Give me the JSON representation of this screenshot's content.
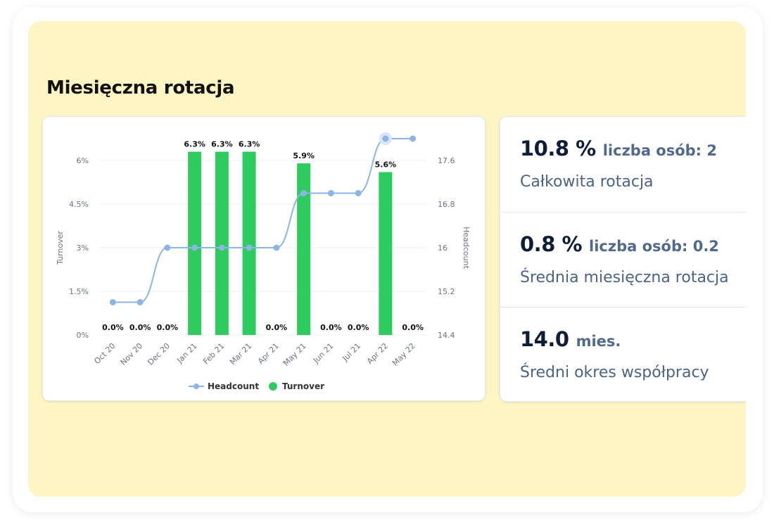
{
  "panel": {
    "title": "Miesięczna rotacja"
  },
  "stats": [
    {
      "value": "10.8 %",
      "extra": "liczba osób: 2",
      "label": "Całkowita rotacja"
    },
    {
      "value": "0.8 %",
      "extra": "liczba osób: 0.2",
      "label": "Średnia miesięczna rotacja"
    },
    {
      "value": "14.0",
      "extra": "mies.",
      "label": "Średni okres współpracy"
    }
  ],
  "colors": {
    "panel_bg": "#fdf6c4",
    "bar": "#2ecc5f",
    "line": "#8db4e6",
    "stat_value": "#0f1d36",
    "stat_text": "#4b6385"
  },
  "chart_data": {
    "type": "bar",
    "categories": [
      "Oct 20",
      "Nov 20",
      "Dec 20",
      "Jan 21",
      "Feb 21",
      "Mar 21",
      "Apr 21",
      "May 21",
      "Jun 21",
      "Jul 21",
      "Apr 22",
      "May 22"
    ],
    "series": [
      {
        "name": "Turnover",
        "type": "bar",
        "axis": "left",
        "values": [
          0,
          0,
          0,
          6.3,
          6.3,
          6.3,
          0,
          5.9,
          0,
          0,
          5.6,
          0
        ],
        "data_labels": [
          "0.0%",
          "0.0%",
          "0.0%",
          "6.3%",
          "6.3%",
          "6.3%",
          "0.0%",
          "5.9%",
          "0.0%",
          "0.0%",
          "5.6%",
          "0.0%"
        ]
      },
      {
        "name": "Headcount",
        "type": "line",
        "axis": "right",
        "values": [
          15.0,
          15.0,
          16.0,
          16.0,
          16.0,
          16.0,
          16.0,
          17.0,
          17.0,
          17.0,
          18.0,
          18.0
        ]
      }
    ],
    "ylabel": "Turnover",
    "y2label": "Headcount",
    "ylim": [
      0,
      6
    ],
    "y2lim": [
      14.4,
      17.6
    ],
    "yticks": [
      "0%",
      "1.5%",
      "3%",
      "4.5%",
      "6%"
    ],
    "y2ticks": [
      "14.4",
      "15.2",
      "16",
      "16.8",
      "17.6"
    ],
    "grid": true,
    "legend": {
      "position": "bottom",
      "entries": [
        "Headcount",
        "Turnover"
      ]
    }
  }
}
